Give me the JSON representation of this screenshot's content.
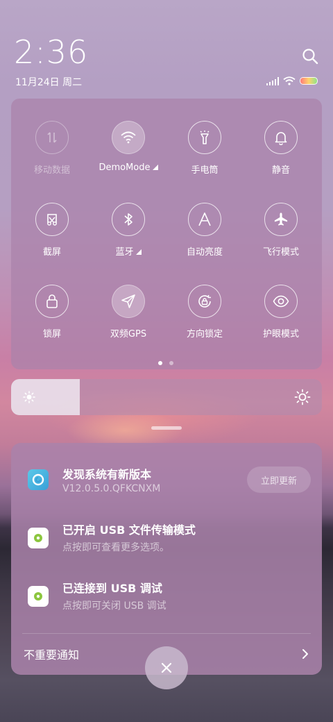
{
  "status_bar": {
    "time": "2:36",
    "date": "11月24日 周二",
    "icons": [
      "signal-icon",
      "wifi-icon",
      "battery-icon"
    ]
  },
  "search": {
    "icon": "search-icon"
  },
  "control_center": {
    "tiles": [
      {
        "label": "移动数据",
        "icon": "mobile-data-icon",
        "state": "disabled"
      },
      {
        "label": "DemoMode",
        "icon": "wifi-icon",
        "state": "on",
        "has_more": true
      },
      {
        "label": "手电筒",
        "icon": "flashlight-icon",
        "state": "off"
      },
      {
        "label": "静音",
        "icon": "bell-icon",
        "state": "off"
      },
      {
        "label": "截屏",
        "icon": "screenshot-icon",
        "state": "off"
      },
      {
        "label": "蓝牙",
        "icon": "bluetooth-icon",
        "state": "off",
        "has_more": true
      },
      {
        "label": "自动亮度",
        "icon": "auto-brightness-icon",
        "state": "off"
      },
      {
        "label": "飞行模式",
        "icon": "airplane-icon",
        "state": "off"
      },
      {
        "label": "锁屏",
        "icon": "lock-icon",
        "state": "off"
      },
      {
        "label": "双频GPS",
        "icon": "gps-icon",
        "state": "on"
      },
      {
        "label": "方向锁定",
        "icon": "rotation-lock-icon",
        "state": "off"
      },
      {
        "label": "护眼模式",
        "icon": "eye-icon",
        "state": "off"
      }
    ],
    "page_count": 2,
    "active_page": 1
  },
  "brightness": {
    "level_percent": 22,
    "icons": [
      "sun-small-icon",
      "sun-large-icon"
    ]
  },
  "notifications": [
    {
      "title": "发现系统有新版本",
      "subtitle": "V12.0.5.0.QFKCNXM",
      "action": "立即更新",
      "icon": "system-update-icon"
    },
    {
      "title": "已开启 USB 文件传输模式",
      "subtitle": "点按即可查看更多选项。",
      "icon": "android-system-icon"
    },
    {
      "title": "已连接到 USB 调试",
      "subtitle": "点按即可关闭 USB 调试",
      "icon": "android-system-icon"
    }
  ],
  "unimportant": {
    "label": "不重要通知",
    "icon": "chevron-right-icon"
  },
  "close": {
    "icon": "close-icon"
  }
}
